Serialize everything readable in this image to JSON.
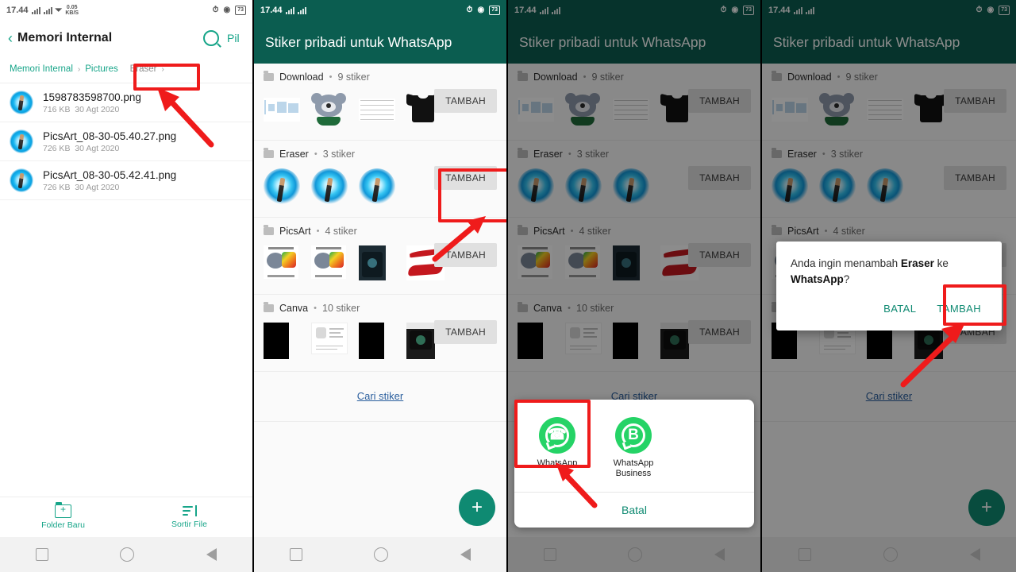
{
  "status_bar": {
    "time": "17.44",
    "net_speed_value": "0.05",
    "net_speed_unit": "KB/S",
    "battery": "73",
    "icons": [
      "signal-bars-icon",
      "signal-bars-icon",
      "wifi-icon",
      "alarm-off-icon",
      "dnd-icon",
      "battery-icon"
    ]
  },
  "panel1": {
    "appbar": {
      "back": "‹",
      "title": "Memori Internal",
      "search_icon": "search-icon",
      "action_label": "Pil"
    },
    "breadcrumb": {
      "root": "Memori Internal",
      "sep": "›",
      "mid": "Pictures",
      "current": "Eraser",
      "current_chevron": "›"
    },
    "files": [
      {
        "name": "1598783598700.png",
        "size": "716 KB",
        "date": "30 Agt 2020"
      },
      {
        "name": "PicsArt_08-30-05.40.27.png",
        "size": "726 KB",
        "date": "30 Agt 2020"
      },
      {
        "name": "PicsArt_08-30-05.42.41.png",
        "size": "726 KB",
        "date": "30 Agt 2020"
      }
    ],
    "bottom_bar": [
      {
        "label": "Folder Baru",
        "icon": "new-folder-icon"
      },
      {
        "label": "Sortir File",
        "icon": "sort-icon"
      }
    ]
  },
  "sticker_screen": {
    "title": "Stiker pribadi untuk WhatsApp",
    "add_label": "TAMBAH",
    "search_link": "Cari stiker",
    "fab_icon": "plus-icon",
    "packs": [
      {
        "name": "Download",
        "count": "9 stiker"
      },
      {
        "name": "Eraser",
        "count": "3 stiker"
      },
      {
        "name": "PicsArt",
        "count": "4 stiker"
      },
      {
        "name": "Canva",
        "count": "10 stiker"
      }
    ]
  },
  "app_chooser": {
    "apps": [
      {
        "name": "WhatsApp",
        "icon": "whatsapp-icon"
      },
      {
        "name": "WhatsApp Business",
        "icon": "whatsapp-business-icon"
      }
    ],
    "cancel": "Batal"
  },
  "confirm_dialog": {
    "text_part1": "Anda ingin menambah ",
    "text_bold1": "Eraser",
    "text_part2": " ke ",
    "text_bold2": "WhatsApp",
    "text_part3": "?",
    "cancel": "BATAL",
    "confirm": "TAMBAH"
  },
  "nav_bar": {
    "recents": "recents-icon",
    "home": "home-icon",
    "back": "back-icon"
  },
  "colors": {
    "teal_header": "#0b5d50",
    "accent_green": "#17a589",
    "highlight_red": "#ef1b1b",
    "link_blue": "#2b5f9e",
    "whatsapp_green": "#25d366"
  }
}
